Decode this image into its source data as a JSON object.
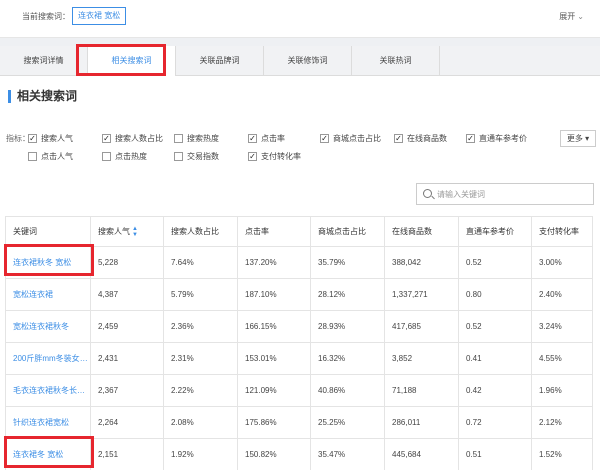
{
  "topbar": {
    "label": "当前搜索词：",
    "tag": "连衣裙 宽松",
    "expand": "展开"
  },
  "tabs": [
    "搜索词详情",
    "相关搜索词",
    "关联品牌词",
    "关联修饰词",
    "关联热词"
  ],
  "section_title": "相关搜索词",
  "metrics": {
    "label": "指标：",
    "row1": [
      {
        "label": "搜索人气",
        "checked": true
      },
      {
        "label": "搜索人数占比",
        "checked": true
      },
      {
        "label": "搜索热度",
        "checked": false
      },
      {
        "label": "点击率",
        "checked": true
      },
      {
        "label": "商城点击占比",
        "checked": true
      },
      {
        "label": "在线商品数",
        "checked": true
      },
      {
        "label": "直通车参考价",
        "checked": true
      }
    ],
    "row2": [
      {
        "label": "点击人气",
        "checked": false
      },
      {
        "label": "点击热度",
        "checked": false
      },
      {
        "label": "交易指数",
        "checked": false
      },
      {
        "label": "支付转化率",
        "checked": true
      }
    ],
    "more": "更多"
  },
  "search": {
    "placeholder": "请输入关键词"
  },
  "table": {
    "headers": [
      "关键词",
      "搜索人气",
      "搜索人数占比",
      "点击率",
      "商城点击占比",
      "在线商品数",
      "直通车参考价",
      "支付转化率"
    ],
    "rows": [
      [
        "连衣裙秋冬 宽松",
        "5,228",
        "7.64%",
        "137.20%",
        "35.79%",
        "388,042",
        "0.52",
        "3.00%"
      ],
      [
        "宽松连衣裙",
        "4,387",
        "5.79%",
        "187.10%",
        "28.12%",
        "1,337,271",
        "0.80",
        "2.40%"
      ],
      [
        "宽松连衣裙秋冬",
        "2,459",
        "2.36%",
        "166.15%",
        "28.93%",
        "417,685",
        "0.52",
        "3.24%"
      ],
      [
        "200斤胖mm冬装女大...",
        "2,431",
        "2.31%",
        "153.01%",
        "16.32%",
        "3,852",
        "0.41",
        "4.55%"
      ],
      [
        "毛衣连衣裙秋冬长款...",
        "2,367",
        "2.22%",
        "121.09%",
        "40.86%",
        "71,188",
        "0.42",
        "1.96%"
      ],
      [
        "针织连衣裙宽松",
        "2,264",
        "2.08%",
        "175.86%",
        "25.25%",
        "286,011",
        "0.72",
        "2.12%"
      ],
      [
        "连衣裙冬 宽松",
        "2,151",
        "1.92%",
        "150.82%",
        "35.47%",
        "445,684",
        "0.51",
        "1.52%"
      ]
    ]
  }
}
